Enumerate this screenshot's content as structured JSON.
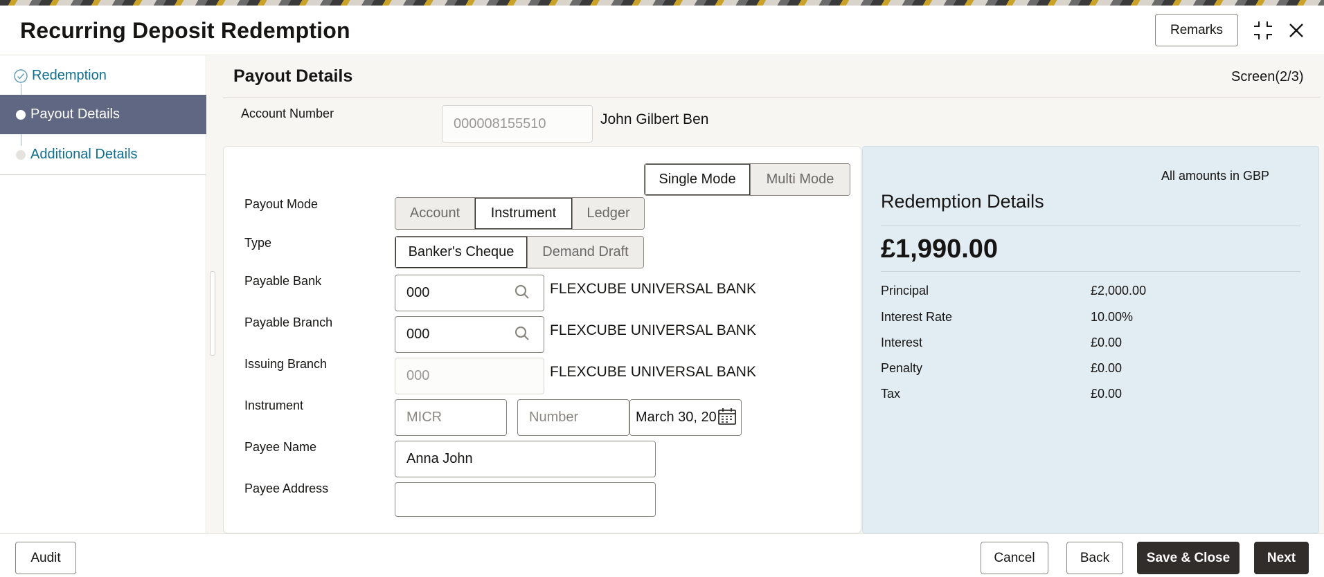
{
  "header": {
    "title": "Recurring Deposit Redemption",
    "remarks_label": "Remarks"
  },
  "sidebar": {
    "steps": [
      {
        "label": "Redemption",
        "state": "completed"
      },
      {
        "label": "Payout Details",
        "state": "active"
      },
      {
        "label": "Additional Details",
        "state": "pending"
      }
    ]
  },
  "main": {
    "section_title": "Payout Details",
    "screen_indicator": "Screen(2/3)",
    "account": {
      "label": "Account Number",
      "value": "000008155510",
      "holder_name": "John Gilbert Ben"
    },
    "mode_toggle": {
      "options": [
        "Single Mode",
        "Multi Mode"
      ],
      "selected": "Single Mode"
    },
    "payout_mode": {
      "label": "Payout Mode",
      "options": [
        "Account",
        "Instrument",
        "Ledger"
      ],
      "selected": "Instrument"
    },
    "type": {
      "label": "Type",
      "options": [
        "Banker's Cheque",
        "Demand Draft"
      ],
      "selected": "Banker's Cheque"
    },
    "payable_bank": {
      "label": "Payable Bank",
      "value": "000",
      "name": "FLEXCUBE UNIVERSAL BANK"
    },
    "payable_branch": {
      "label": "Payable Branch",
      "value": "000",
      "name": "FLEXCUBE UNIVERSAL BANK"
    },
    "issuing_branch": {
      "label": "Issuing Branch",
      "value": "000",
      "name": "FLEXCUBE UNIVERSAL BANK"
    },
    "instrument": {
      "label": "Instrument",
      "micr_placeholder": "MICR",
      "number_placeholder": "Number",
      "date_value": "March 30, 20"
    },
    "payee_name": {
      "label": "Payee Name",
      "value": "Anna John"
    },
    "payee_address": {
      "label": "Payee Address",
      "value": ""
    }
  },
  "redemption_details": {
    "currency_note": "All amounts in GBP",
    "title": "Redemption Details",
    "total": "£1,990.00",
    "rows": [
      {
        "label": "Principal",
        "value": "£2,000.00"
      },
      {
        "label": "Interest Rate",
        "value": "10.00%"
      },
      {
        "label": "Interest",
        "value": "£0.00"
      },
      {
        "label": "Penalty",
        "value": "£0.00"
      },
      {
        "label": "Tax",
        "value": "£0.00"
      }
    ]
  },
  "footer": {
    "audit_label": "Audit",
    "cancel_label": "Cancel",
    "back_label": "Back",
    "save_close_label": "Save & Close",
    "next_label": "Next"
  },
  "colors": {
    "accent_teal": "#0f6e8f",
    "active_step_bg": "#5f6783",
    "dark_button": "#312d2a",
    "details_panel_bg": "#e1ecf3"
  }
}
